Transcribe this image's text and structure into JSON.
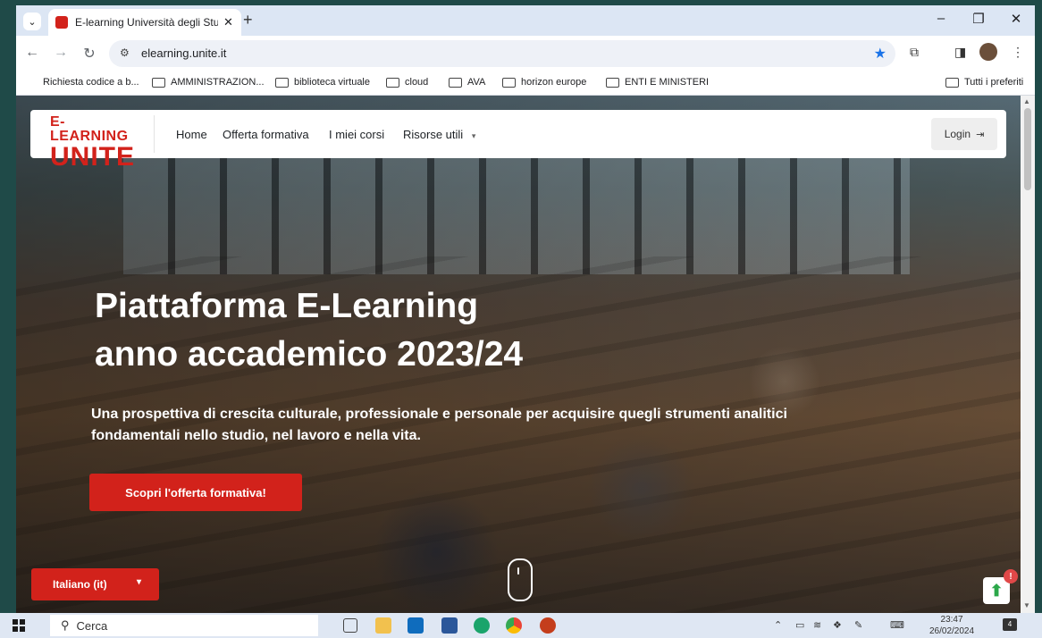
{
  "browser": {
    "tab_title": "E-learning Università degli Stud",
    "tab_close": "✕",
    "new_tab": "+",
    "url": "elearning.unite.it",
    "window_controls": {
      "minimize": "–",
      "restore": "❐",
      "close": "✕"
    }
  },
  "bookmarks": {
    "items": [
      {
        "label": "Richiesta codice a b..."
      },
      {
        "label": "AMMINISTRAZION..."
      },
      {
        "label": "biblioteca virtuale"
      },
      {
        "label": "cloud"
      },
      {
        "label": "AVA"
      },
      {
        "label": "horizon europe"
      },
      {
        "label": "ENTI E MINISTERI"
      }
    ],
    "all_label": "Tutti i preferiti"
  },
  "site": {
    "logo_line1": "E-LEARNING",
    "logo_line2": "UNITE",
    "nav": {
      "home": "Home",
      "offerta": "Offerta formativa",
      "corsi": "I miei corsi",
      "risorse": "Risorse utili"
    },
    "login": "Login"
  },
  "hero": {
    "title_line1": "Piattaforma E-Learning",
    "title_line2": "anno accademico 2023/24",
    "subtitle": "Una prospettiva di crescita culturale, professionale e personale per acquisire quegli strumenti analitici fondamentali nello studio, nel lavoro e nella vita.",
    "cta": "Scopri l'offerta formativa!"
  },
  "language": {
    "label": "Italiano (it)"
  },
  "notification_badge": "!",
  "taskbar": {
    "search_placeholder": "Cerca",
    "time": "23:47",
    "date": "26/02/2024",
    "notif_count": "4"
  },
  "colors": {
    "brand_red": "#d2221b",
    "browser_chrome": "#dfe7f3",
    "desktop": "#1f4a48"
  }
}
